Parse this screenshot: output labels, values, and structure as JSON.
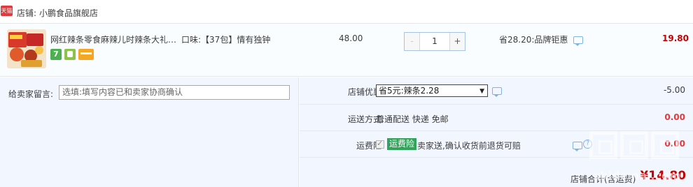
{
  "shop": {
    "badge_text": "天猫",
    "label": "店铺:",
    "name": "小鹏食品旗舰店"
  },
  "item": {
    "image_icon": "product-thumbnail",
    "title": "网红辣条零食麻辣儿时辣条大礼…",
    "icons": [
      "seven-day-return-icon",
      "promo-icon",
      "card-icon"
    ],
    "seven_label": "7",
    "sku": "口味:【37包】情有独钟",
    "unit_price": "48.00",
    "quantity": {
      "minus": "-",
      "value": "1",
      "plus": "+"
    },
    "discount": "省28.20:品牌钜惠",
    "subtotal": "19.80"
  },
  "message": {
    "label": "给卖家留言:",
    "placeholder": "选填:填写内容已和卖家协商确认"
  },
  "shop_discount": {
    "label": "店铺优惠:",
    "selected": "省5元:辣条2.28",
    "value": "-5.00"
  },
  "shipping": {
    "label": "运送方式:",
    "text": "普通配送 快递 免邮",
    "value": "0.00"
  },
  "insurance": {
    "label": "运费险:",
    "badge": "运费险",
    "text": "卖家送,确认收货前退货可赔",
    "value": "0.00"
  },
  "total": {
    "label": "店铺合计(含运费)",
    "value": "¥14.80"
  },
  "watermark": {
    "text": "zhidemai.com"
  },
  "colors": {
    "price_red": "#c40000",
    "panel_bg": "#f2f7ff",
    "insurance_green": "#32a35b",
    "tmall_red": "#e4393c"
  }
}
